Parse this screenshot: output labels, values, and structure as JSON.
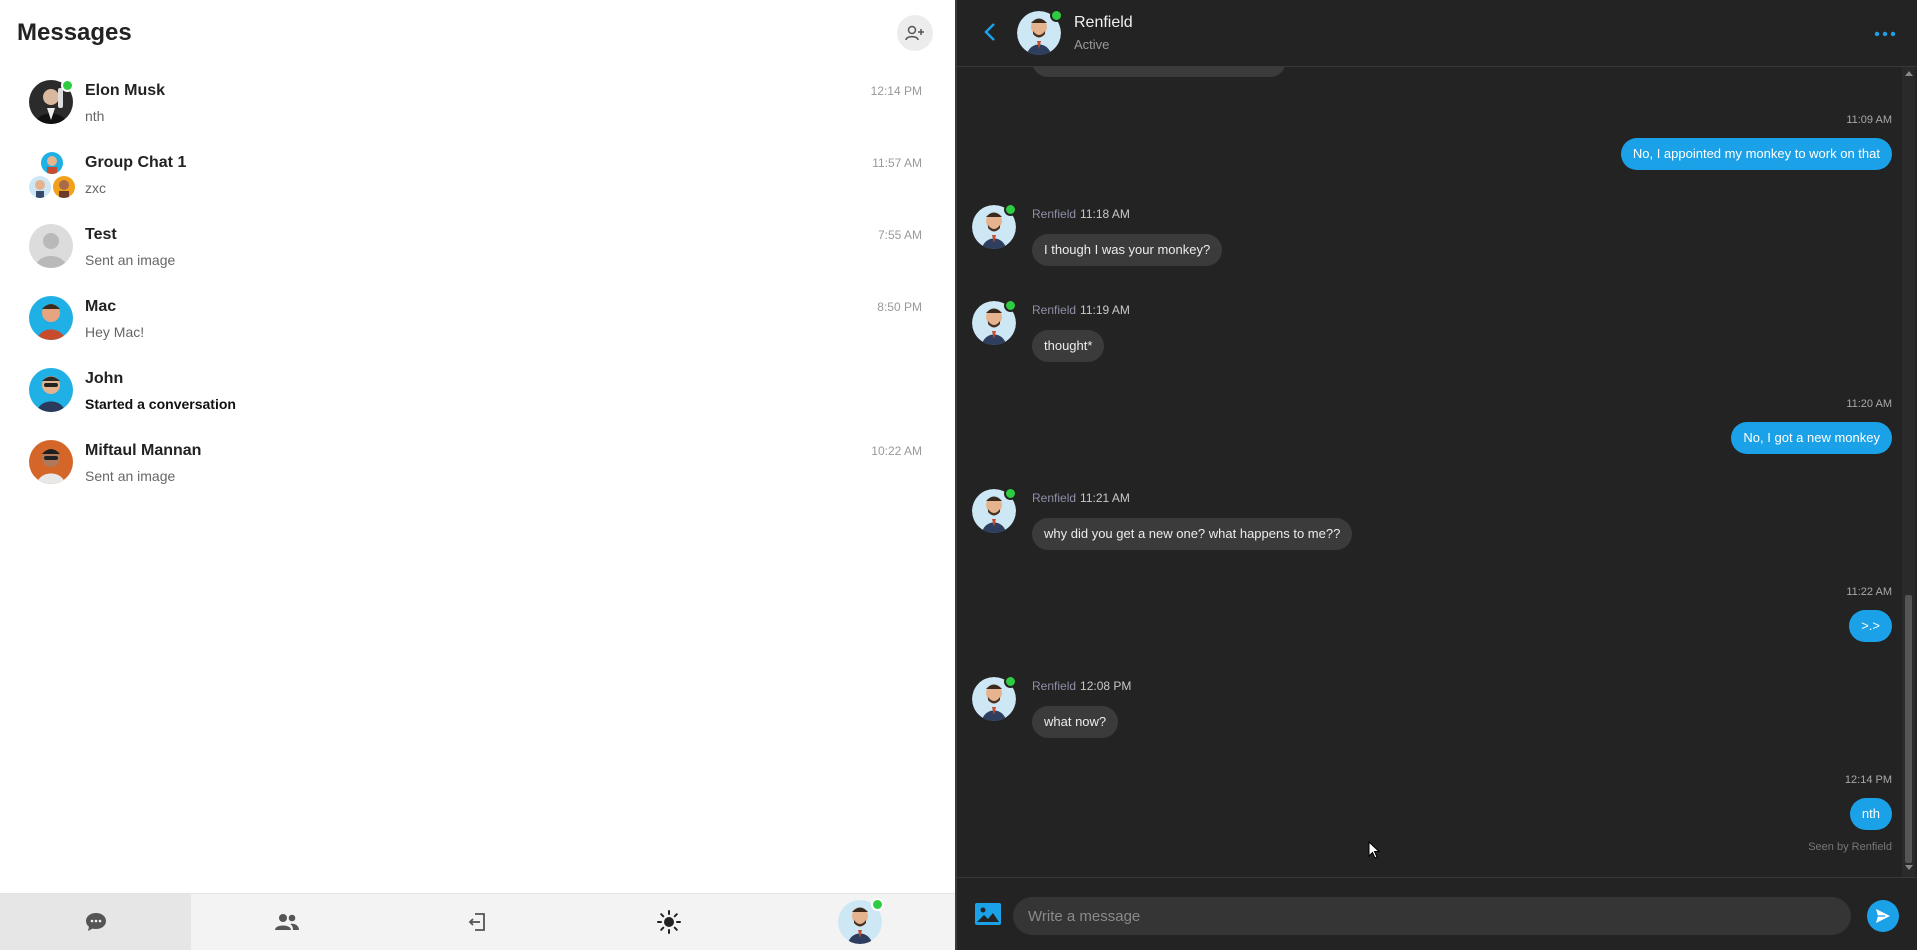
{
  "left": {
    "title": "Messages",
    "conversations": [
      {
        "name": "Elon Musk",
        "preview": "nth",
        "time": "12:14 PM",
        "online": true
      },
      {
        "name": "Group Chat 1",
        "preview": "zxc",
        "time": "11:57 AM"
      },
      {
        "name": "Test",
        "preview": "Sent an image",
        "time": "7:55 AM"
      },
      {
        "name": "Mac",
        "preview": "Hey Mac!",
        "time": "8:50 PM"
      },
      {
        "name": "John",
        "preview": "Started a conversation",
        "time": ""
      },
      {
        "name": "Miftaul Mannan",
        "preview": "Sent an image",
        "time": "10:22 AM"
      }
    ]
  },
  "bottom_nav": {
    "icons": [
      "chat-icon",
      "people-icon",
      "logout-icon",
      "sun-icon",
      "profile-avatar"
    ]
  },
  "chat": {
    "contact_name": "Renfield",
    "contact_status": "Active",
    "messages": [
      {
        "dir": "out",
        "time": "11:09 AM",
        "text": "No, I appointed my monkey to work on that"
      },
      {
        "dir": "in",
        "sender": "Renfield",
        "time": "11:18 AM",
        "text": "I though I was your monkey?"
      },
      {
        "dir": "in",
        "sender": "Renfield",
        "time": "11:19 AM",
        "text": "thought*"
      },
      {
        "dir": "out",
        "time": "11:20 AM",
        "text": "No, I got a new monkey"
      },
      {
        "dir": "in",
        "sender": "Renfield",
        "time": "11:21 AM",
        "text": "why did you get a new one? what happens to me??"
      },
      {
        "dir": "out",
        "time": "11:22 AM",
        "text": ">.>"
      },
      {
        "dir": "in",
        "sender": "Renfield",
        "time": "12:08 PM",
        "text": "what now?"
      },
      {
        "dir": "out",
        "time": "12:14 PM",
        "text": "nth"
      }
    ],
    "seen_text": "Seen by Renfield",
    "composer_placeholder": "Write a message"
  },
  "colors": {
    "accent": "#1ba1e8",
    "online": "#2ecc40",
    "dark_bg": "#232323"
  }
}
